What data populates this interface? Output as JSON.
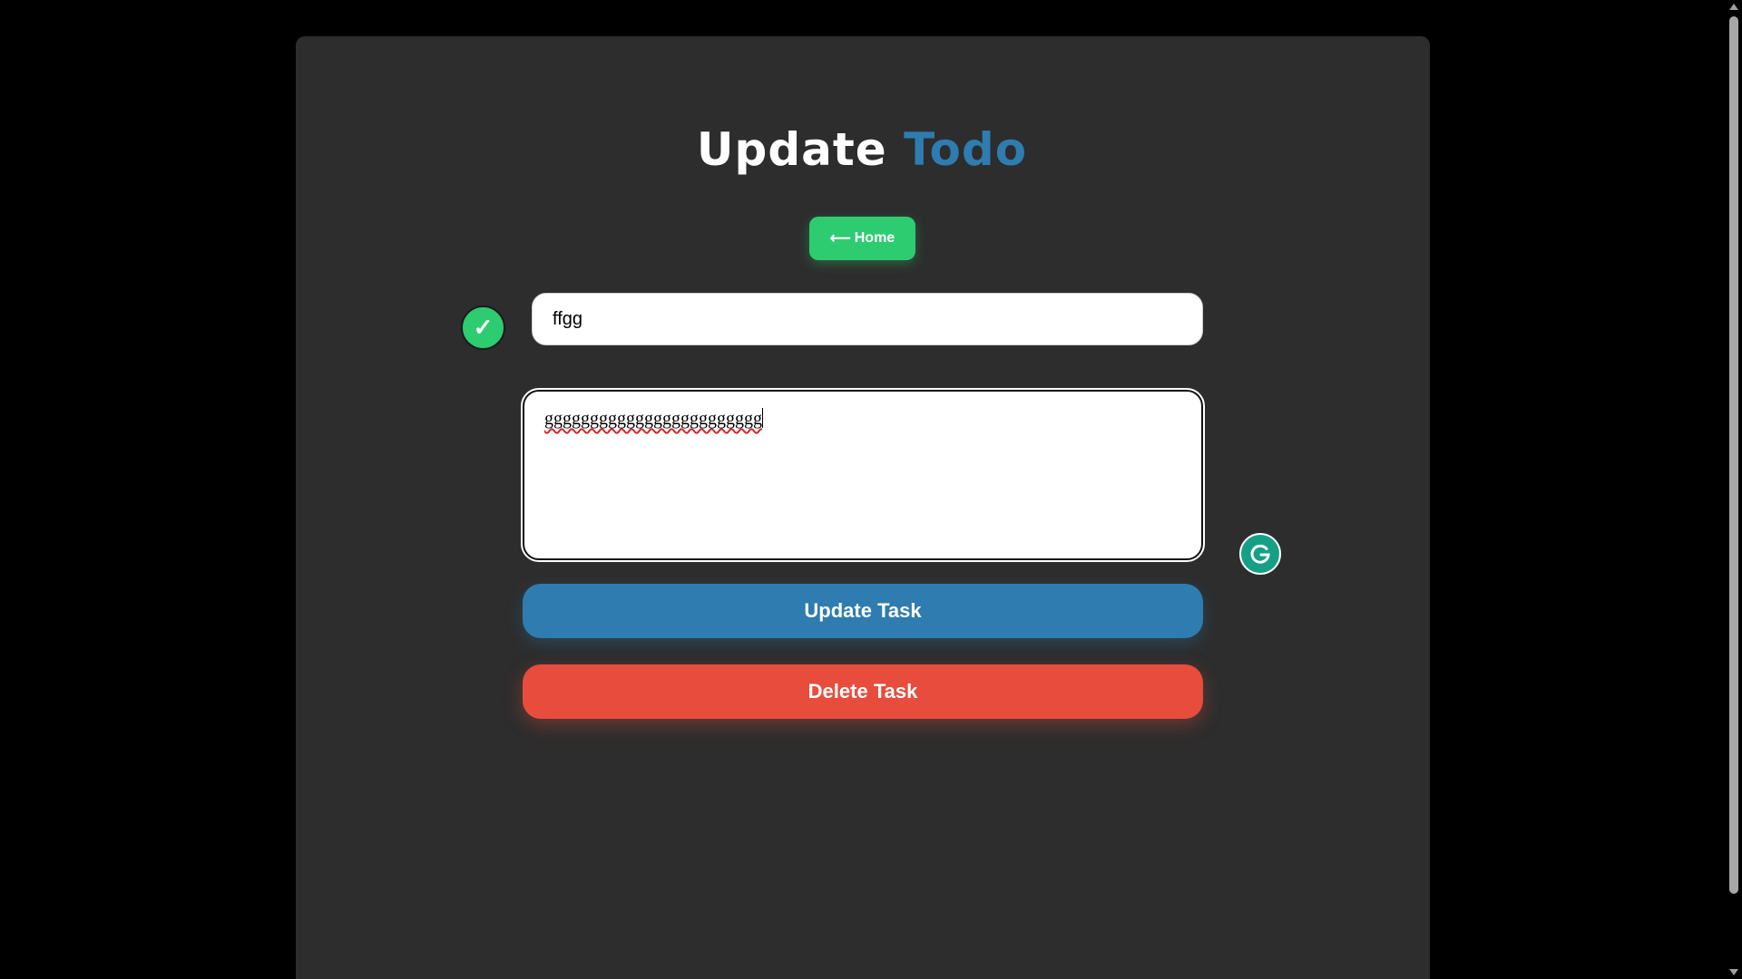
{
  "header": {
    "title_word1": "Update",
    "title_word2": "Todo"
  },
  "nav": {
    "home_arrow": "⟵",
    "home_label": "Home"
  },
  "task": {
    "completed": true,
    "check_glyph": "✓",
    "title_value": "ffgg",
    "description_value": "gggggggggggggggggggggggg"
  },
  "actions": {
    "update_label": "Update Task",
    "delete_label": "Delete Task"
  },
  "grammarly": {
    "icon": "grammarly-icon",
    "glyph": "G"
  },
  "colors": {
    "page_background": "#000000",
    "card_background": "#2d2d2d",
    "accent_blue": "#2e7cb0",
    "accent_green": "#2ecc71",
    "accent_red": "#e74c3c",
    "grammarly_green": "#15a085"
  }
}
